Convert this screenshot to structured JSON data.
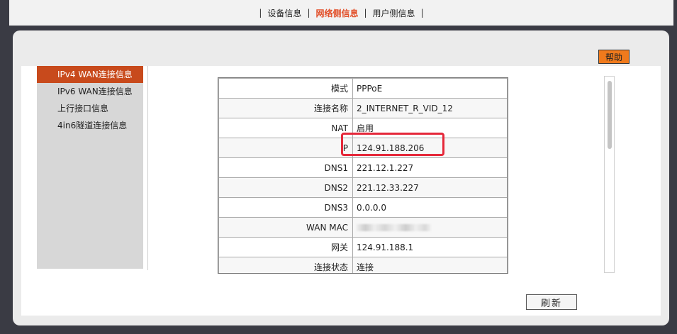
{
  "topnav": {
    "separator": "|",
    "items": [
      {
        "label": "设备信息",
        "active": false
      },
      {
        "label": "网络侧信息",
        "active": true
      },
      {
        "label": "用户侧信息",
        "active": false
      }
    ]
  },
  "help_label": "帮助",
  "sidebar": {
    "items": [
      {
        "label": "IPv4 WAN连接信息",
        "active": true
      },
      {
        "label": "IPv6 WAN连接信息",
        "active": false
      },
      {
        "label": "上行接口信息",
        "active": false
      },
      {
        "label": "4in6隧道连接信息",
        "active": false
      }
    ]
  },
  "wan_table": {
    "rows": [
      {
        "label": "模式",
        "value": "PPPoE"
      },
      {
        "label": "连接名称",
        "value": "2_INTERNET_R_VID_12"
      },
      {
        "label": "NAT",
        "value": "启用"
      },
      {
        "label": "IP",
        "value": "124.91.188.206"
      },
      {
        "label": "DNS1",
        "value": "221.12.1.227"
      },
      {
        "label": "DNS2",
        "value": "221.12.33.227"
      },
      {
        "label": "DNS3",
        "value": "0.0.0.0"
      },
      {
        "label": "WAN MAC",
        "value": ""
      },
      {
        "label": "网关",
        "value": "124.91.188.1"
      },
      {
        "label": "连接状态",
        "value": "连接"
      }
    ]
  },
  "refresh_label": "刷新",
  "colors": {
    "accent_orange": "#f07a1c",
    "active_sidebar": "#c84a1c",
    "active_nav": "#e2502a",
    "highlight_box": "#e5283a"
  }
}
